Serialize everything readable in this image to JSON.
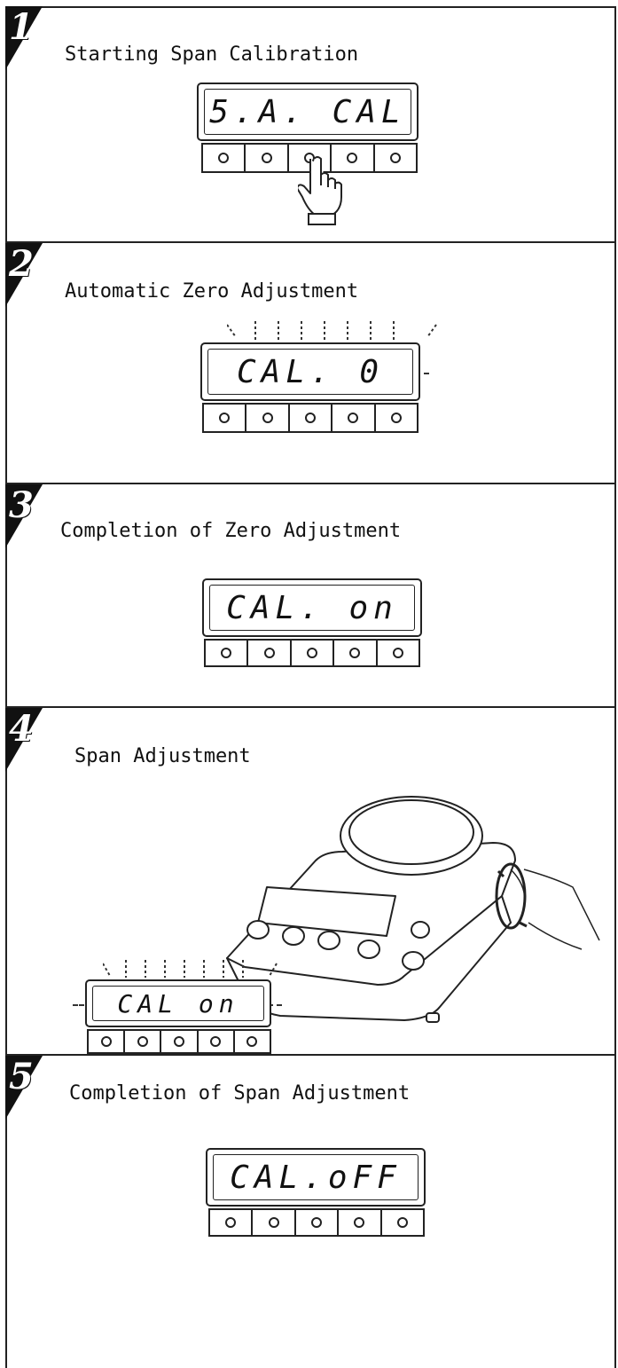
{
  "header_fragment": "",
  "steps": [
    {
      "number": "1",
      "title": "Starting Span Calibration",
      "display": "5.A. CAL"
    },
    {
      "number": "2",
      "title": "Automatic Zero Adjustment",
      "display": "CAL. 0"
    },
    {
      "number": "3",
      "title": "Completion of Zero Adjustment",
      "display": "CAL. on"
    },
    {
      "number": "4",
      "title": "Span Adjustment",
      "display": "CAL on"
    },
    {
      "number": "5",
      "title": "Completion of Span Adjustment",
      "display": "CAL.oFF"
    }
  ],
  "icons": {
    "hand": "pointing-hand-icon",
    "scale": "balance-scale-illustration",
    "dial": "adjustment-dial-icon"
  }
}
